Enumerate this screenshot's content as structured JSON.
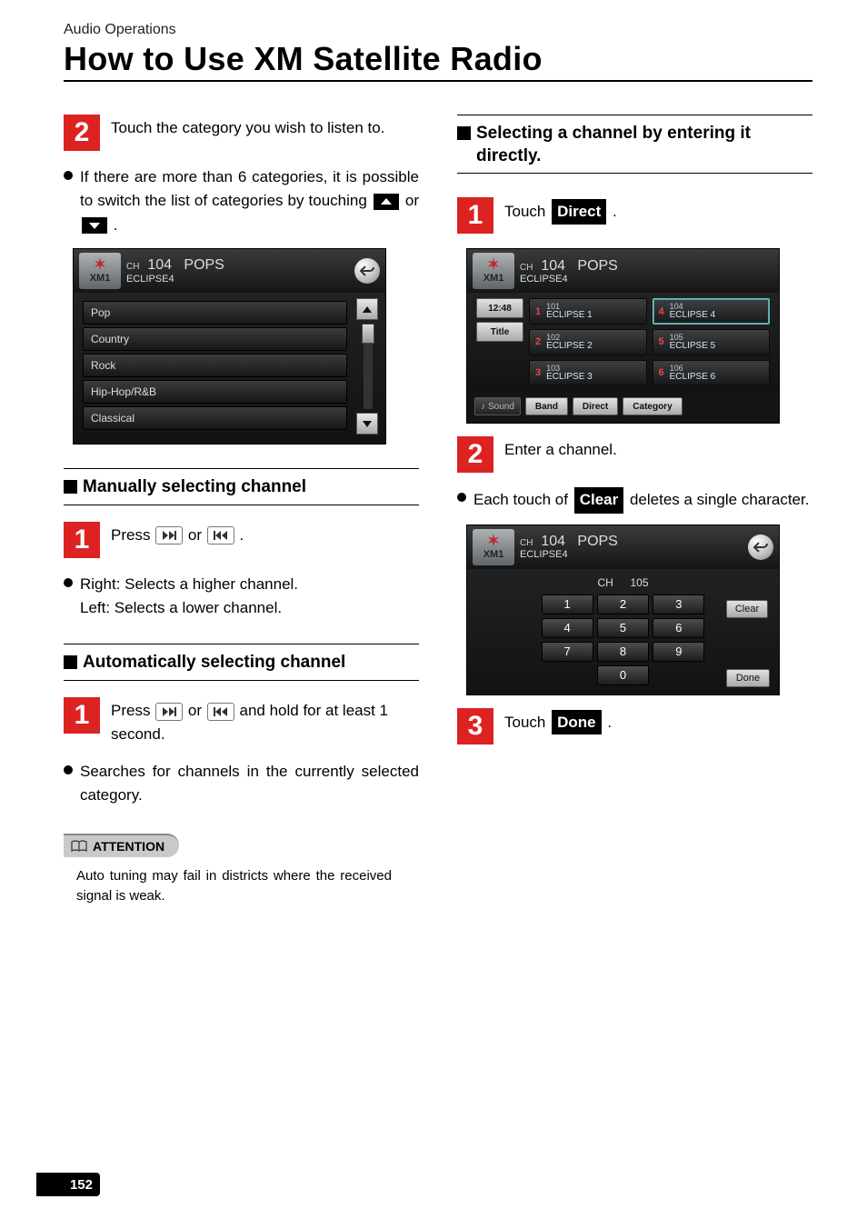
{
  "breadcrumb": "Audio Operations",
  "title": "How to Use XM Satellite Radio",
  "pageNumber": "152",
  "left": {
    "step2": "Touch the category you wish to listen to.",
    "bullet1_pre": "If there are more than 6 categories, it is possible to switch the list of categories by touching ",
    "bullet1_mid": " or ",
    "bullet1_post": ".",
    "shot1": {
      "band": "XM1",
      "chLabel": "CH",
      "ch": "104",
      "genre": "POPS",
      "station": "ECLIPSE4",
      "categories": [
        "Pop",
        "Country",
        "Rock",
        "Hip-Hop/R&B",
        "Classical"
      ]
    },
    "sec_manual": "Manually selecting channel",
    "manual_step1_a": "Press ",
    "manual_step1_b": " or ",
    "manual_step1_c": ".",
    "manual_bullet_r": "Right: Selects a higher channel.",
    "manual_bullet_l": "Left: Selects a lower channel.",
    "sec_auto": "Automatically selecting channel",
    "auto_step1_a": "Press ",
    "auto_step1_b": " or ",
    "auto_step1_c": " and hold for at least 1 second.",
    "auto_bullet": "Searches for channels in the currently selected category.",
    "attention_label": "ATTENTION",
    "attention_text": "Auto tuning may fail in districts where the received signal is weak."
  },
  "right": {
    "sec_direct": "Selecting a channel by entering it directly.",
    "step1_a": "Touch ",
    "step1_btn": "Direct",
    "step1_b": ".",
    "shot2": {
      "band": "XM1",
      "chLabel": "CH",
      "ch": "104",
      "genre": "POPS",
      "station": "ECLIPSE4",
      "time": "12:48",
      "titleBtn": "Title",
      "presets": [
        {
          "n": "1",
          "ch": "101",
          "name": "ECLIPSE 1"
        },
        {
          "n": "4",
          "ch": "104",
          "name": "ECLIPSE 4",
          "active": true
        },
        {
          "n": "2",
          "ch": "102",
          "name": "ECLIPSE 2"
        },
        {
          "n": "5",
          "ch": "105",
          "name": "ECLIPSE 5"
        },
        {
          "n": "3",
          "ch": "103",
          "name": "ECLIPSE 3"
        },
        {
          "n": "6",
          "ch": "106",
          "name": "ECLIPSE 6"
        }
      ],
      "sound": "Sound",
      "band_b": "Band",
      "direct": "Direct",
      "category": "Category"
    },
    "step2": "Enter a channel.",
    "bullet2_a": "Each touch of ",
    "bullet2_btn": "Clear",
    "bullet2_b": " deletes a single character.",
    "shot3": {
      "band": "XM1",
      "chLabel": "CH",
      "ch": "104",
      "genre": "POPS",
      "station": "ECLIPSE4",
      "input_chLabel": "CH",
      "input_ch": "105",
      "keys": [
        "1",
        "2",
        "3",
        "4",
        "5",
        "6",
        "7",
        "8",
        "9",
        "0"
      ],
      "clear": "Clear",
      "done": "Done"
    },
    "step3_a": "Touch ",
    "step3_btn": "Done",
    "step3_b": "."
  }
}
